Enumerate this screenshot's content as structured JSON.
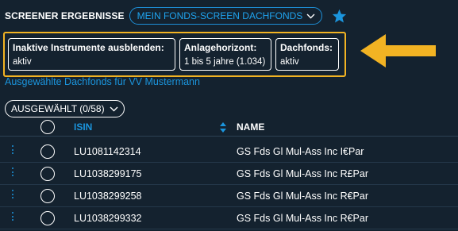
{
  "header": {
    "title": "SCREENER ERGEBNISSE",
    "screen_name": "MEIN FONDS-SCREEN DACHFONDS"
  },
  "filters": [
    {
      "title": "Inaktive Instrumente ausblenden:",
      "value": "aktiv"
    },
    {
      "title": "Anlagehorizont:",
      "value": "1 bis 5 jahre (1.034)"
    },
    {
      "title": "Dachfonds:",
      "value": "aktiv"
    }
  ],
  "fund_link": "Ausgewählte Dachfonds für VV Mustermann",
  "selected_label": "AUSGEWÄHLT (0/58)",
  "table": {
    "columns": {
      "isin": "ISIN",
      "name": "NAME"
    },
    "rows": [
      {
        "isin": "LU1081142314",
        "name": "GS Fds Gl Mul-Ass Inc I€Par"
      },
      {
        "isin": "LU1038299175",
        "name": "GS Fds Gl Mul-Ass Inc R£Par"
      },
      {
        "isin": "LU1038299258",
        "name": "GS Fds Gl Mul-Ass Inc R€Par"
      },
      {
        "isin": "LU1038299332",
        "name": "GS Fds Gl Mul-Ass Inc R€Par"
      }
    ]
  },
  "colors": {
    "background": "#14222f",
    "accent_blue": "#1b95dd",
    "highlight_orange": "#f2b323"
  },
  "icons": {
    "dropdown": "chevron-down-icon",
    "favorite": "star-icon",
    "sort": "sort-icon",
    "row_menu": "more-vertical-icon",
    "annotation": "arrow-left-icon"
  }
}
